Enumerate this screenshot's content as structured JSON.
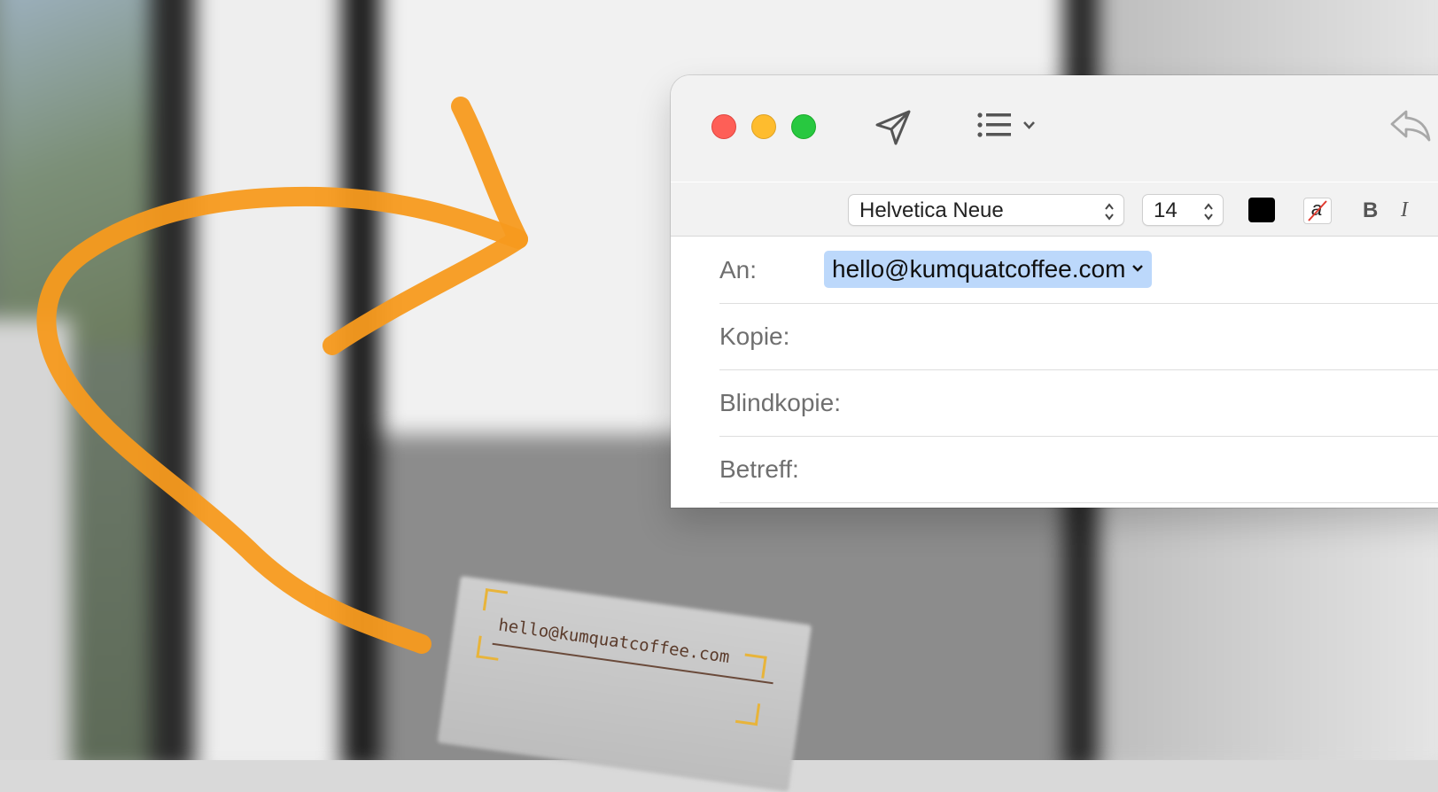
{
  "window": {
    "font_name": "Helvetica Neue",
    "font_size": "14",
    "bold_label": "B",
    "italic_label": "I",
    "strike_label": "a"
  },
  "headers": {
    "to_label": "An:",
    "to_value": "hello@kumquatcoffee.com",
    "cc_label": "Kopie:",
    "bcc_label": "Blindkopie:",
    "subject_label": "Betreff:"
  },
  "card": {
    "email": "hello@kumquatcoffee.com"
  },
  "colors": {
    "accent_arrow": "#f79a1e",
    "token_bg": "#bcd8fb",
    "close": "#fe5f57",
    "minimize": "#febc2e",
    "zoom": "#28c840"
  },
  "icons": [
    "send-icon",
    "list-format-icon",
    "reply-icon",
    "chevron-down-icon",
    "up-down-icon"
  ]
}
